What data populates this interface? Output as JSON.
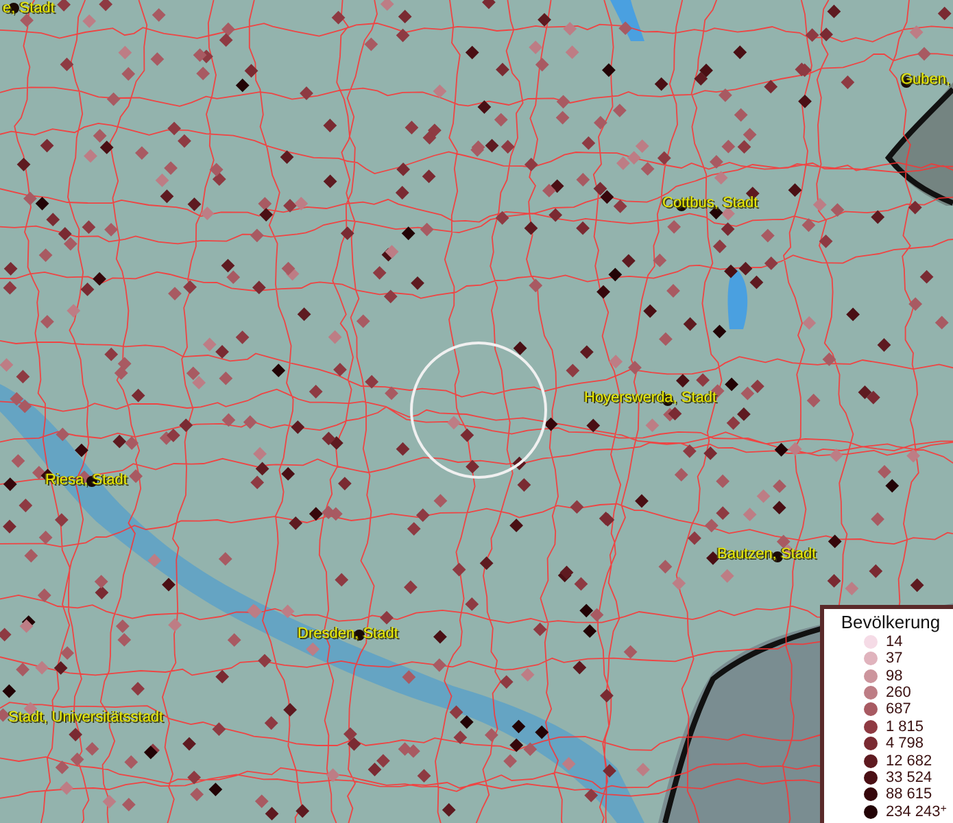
{
  "map": {
    "places": [
      {
        "name": "e, Stadt"
      },
      {
        "name": "Guben,"
      },
      {
        "name": "Cottbus, Stadt"
      },
      {
        "name": "Hoyerswerda, Stadt"
      },
      {
        "name": "Riesa, Stadt"
      },
      {
        "name": "Bautzen, Stadt"
      },
      {
        "name": "Dresden, Stadt"
      },
      {
        "name": "Stadt, Universitätsstadt"
      }
    ]
  },
  "legend": {
    "title": "Bevölkerung",
    "items": [
      {
        "label": "14",
        "color": "#f5dbe6"
      },
      {
        "label": "37",
        "color": "#e0b3bd"
      },
      {
        "label": "98",
        "color": "#cc959d"
      },
      {
        "label": "260",
        "color": "#bd7d85"
      },
      {
        "label": "687",
        "color": "#a85a62"
      },
      {
        "label": "1 815",
        "color": "#8e3a42"
      },
      {
        "label": "4 798",
        "color": "#7a2a32"
      },
      {
        "label": "12 682",
        "color": "#5e1a20"
      },
      {
        "label": "33 524",
        "color": "#4a0f14"
      },
      {
        "label": "88 615",
        "color": "#36070b"
      },
      {
        "label": "234 243$^{+}$",
        "color": "#220305"
      }
    ]
  }
}
